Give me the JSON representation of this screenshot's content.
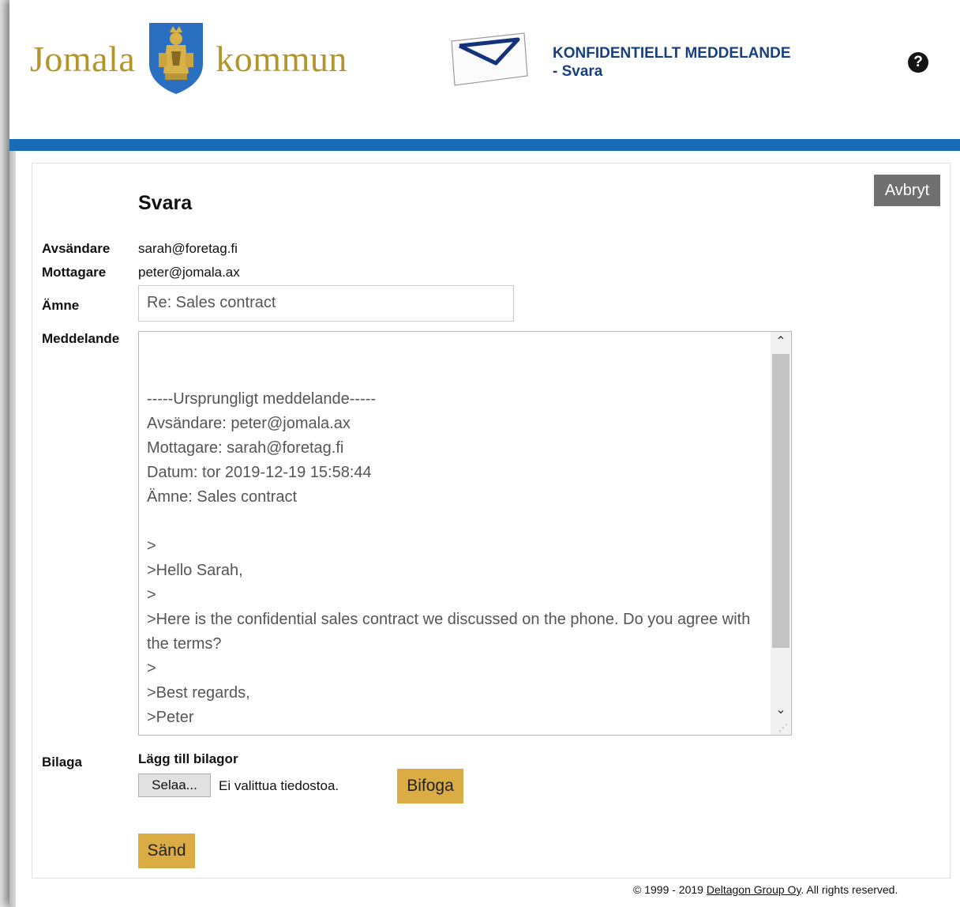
{
  "header": {
    "logo_left": "Jomala",
    "logo_right": "kommun",
    "conf_line1": "KONFIDENTIELLT MEDDELANDE",
    "conf_line2": "- Svara"
  },
  "colors": {
    "blue_bar": "#1a6bb5",
    "gold": "#b3952e",
    "button_gold": "#dcac44",
    "cancel_grey": "#707070",
    "title_blue": "#18407f"
  },
  "icons": {
    "help": "question-circle-icon",
    "envelope": "envelope-icon",
    "crest": "coat-of-arms-icon"
  },
  "form": {
    "cancel_label": "Avbryt",
    "title": "Svara",
    "sender_label": "Avsändare",
    "sender_value": "sarah@foretag.fi",
    "recipient_label": "Mottagare",
    "recipient_value": "peter@jomala.ax",
    "subject_label": "Ämne",
    "subject_value": "Re: Sales contract",
    "message_label": "Meddelande",
    "message_value": "-----Ursprungligt meddelande-----\nAvsändare: peter@jomala.ax\nMottagare: sarah@foretag.fi\nDatum: tor 2019-12-19 15:58:44\nÄmne: Sales contract\n\n>\n>Hello Sarah,\n>\n>Here is the confidential sales contract we discussed on the phone. Do you agree with the terms?\n>\n>Best regards,\n>Peter",
    "attachment_label": "Bilaga",
    "add_attachments_label": "Lägg till bilagor",
    "browse_label": "Selaa...",
    "no_file_text": "Ei valittua tiedostoa.",
    "attach_label": "Bifoga",
    "send_label": "Sänd"
  },
  "footer": {
    "prefix": "© 1999 - 2019 ",
    "company": "Deltagon Group Oy",
    "suffix": ". All rights reserved."
  }
}
